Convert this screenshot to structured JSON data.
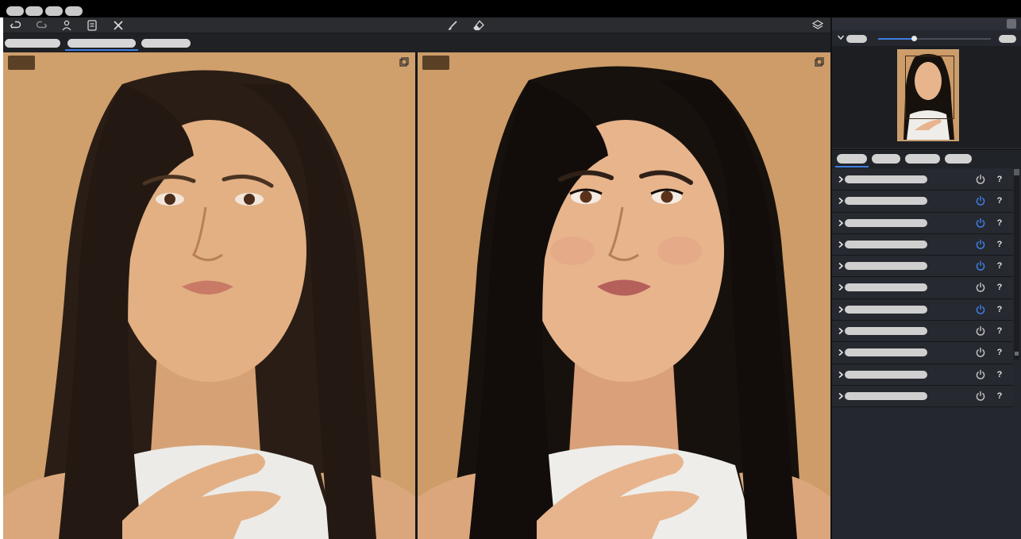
{
  "window": {
    "top_pills": [
      "",
      "",
      "",
      ""
    ]
  },
  "toolbar": {
    "left_icons": [
      "undo-icon",
      "redo-icon",
      "person-icon",
      "preset-icon",
      "close-icon"
    ],
    "center_icons": [
      "brush-icon",
      "eraser-icon"
    ],
    "right_icon": "layers-icon"
  },
  "view_tabs": [
    {
      "label": "",
      "active": false
    },
    {
      "label": "",
      "active": true
    },
    {
      "label": "",
      "active": false
    }
  ],
  "panels": {
    "before": {
      "label": ""
    },
    "after": {
      "label": ""
    }
  },
  "navigator": {
    "zoom_label": "",
    "zoom_level": 0.32,
    "fit_label": ""
  },
  "sidebar_tabs": [
    {
      "label": "",
      "active": true
    },
    {
      "label": "",
      "active": false
    },
    {
      "label": "",
      "active": false
    },
    {
      "label": "",
      "active": false
    }
  ],
  "tools": [
    {
      "label": "",
      "enabled": false,
      "help": "?"
    },
    {
      "label": "",
      "enabled": true,
      "help": "?"
    },
    {
      "label": "",
      "enabled": true,
      "help": "?"
    },
    {
      "label": "",
      "enabled": true,
      "help": "?"
    },
    {
      "label": "",
      "enabled": true,
      "help": "?"
    },
    {
      "label": "",
      "enabled": false,
      "help": "?"
    },
    {
      "label": "",
      "enabled": true,
      "help": "?"
    },
    {
      "label": "",
      "enabled": false,
      "help": "?"
    },
    {
      "label": "",
      "enabled": false,
      "help": "?"
    },
    {
      "label": "",
      "enabled": false,
      "help": "?"
    },
    {
      "label": "",
      "enabled": false,
      "help": "?"
    }
  ],
  "colors": {
    "accent": "#3f7de0",
    "power_off": "#bdbdbd",
    "background_tan": "#cf9f6c"
  }
}
